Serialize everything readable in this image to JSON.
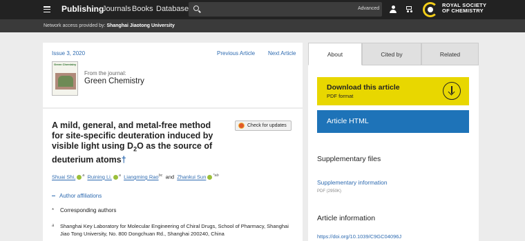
{
  "topbar": {
    "brand": "Publishing",
    "nav": [
      "Journals",
      "Books",
      "Databases"
    ],
    "search_advanced": "Advanced",
    "logo_text_line1": "ROYAL SOCIETY",
    "logo_text_line2": "OF CHEMISTRY"
  },
  "access": {
    "prefix": "Network access provided by:",
    "institution": "Shanghai Jiaotong University"
  },
  "journal_card": {
    "issue": "Issue 3, 2020",
    "prev": "Previous Article",
    "next": "Next Article",
    "cover_title": "Green Chemistry",
    "from_journal": "From the journal:",
    "journal_name": "Green Chemistry"
  },
  "article": {
    "title_part1": "A mild, general, and metal-free method for site-specific deuteration induced by visible light using D",
    "title_sub": "2",
    "title_part2": "O as the source of deuterium atoms",
    "title_dagger": "†",
    "check_updates": "Check for updates",
    "authors": [
      {
        "name": "Shuai Shi,",
        "sup": "a"
      },
      {
        "name": "Ruining Li,",
        "sup": "a"
      },
      {
        "name": "Liangming Rao",
        "sup": "bc"
      },
      {
        "name": "Zhankui Sun",
        "sup": "*ab"
      }
    ],
    "and_word": "and",
    "affiliations_toggle": "Author affiliations",
    "corresponding_star": "*",
    "corresponding_label": "Corresponding authors",
    "aff_a_label": "a",
    "aff_a_text": "Shanghai Key Laboratory for Molecular Engineering of Chiral Drugs, School of Pharmacy, Shanghai Jiao Tong University, No. 800 Dongchuan Rd., Shanghai 200240, China"
  },
  "side": {
    "tabs": [
      "About",
      "Cited by",
      "Related"
    ],
    "active_tab": "About",
    "download_title": "Download this article",
    "download_sub": "PDF format",
    "html_label": "Article HTML",
    "supp_heading": "Supplementary files",
    "supp_link": "Supplementary information",
    "supp_size": "PDF (2950K)",
    "info_heading": "Article information",
    "doi": "https://doi.org/10.1039/C9GC04096J"
  },
  "colors": {
    "topbar": "#222222",
    "accessbar": "#3a3a3a",
    "download": "#e8d700",
    "html_button": "#1e73b8",
    "link": "#2d6ab0"
  }
}
